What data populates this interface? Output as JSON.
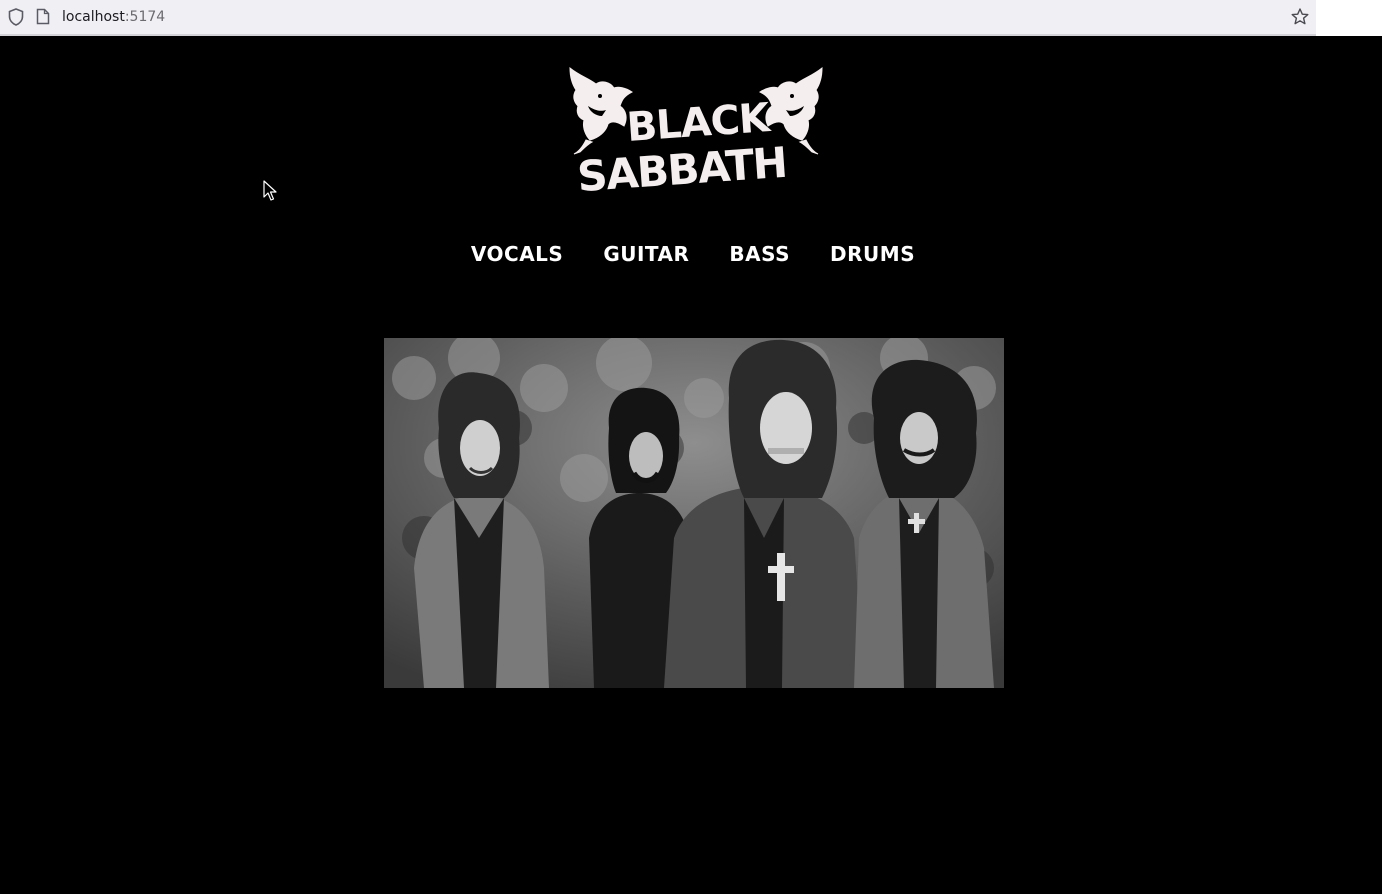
{
  "browser": {
    "url_host": "localhost",
    "url_port": ":5174"
  },
  "logo": {
    "line1": "BLACK",
    "line2": "SABBATH"
  },
  "nav": {
    "items": [
      {
        "label": "VOCALS"
      },
      {
        "label": "GUITAR"
      },
      {
        "label": "BASS"
      },
      {
        "label": "DRUMS"
      }
    ]
  },
  "photo": {
    "description_icon": "band-photo"
  },
  "colors": {
    "background": "#000000",
    "text": "#ffffff",
    "urlbar": "#f0f0f4"
  }
}
